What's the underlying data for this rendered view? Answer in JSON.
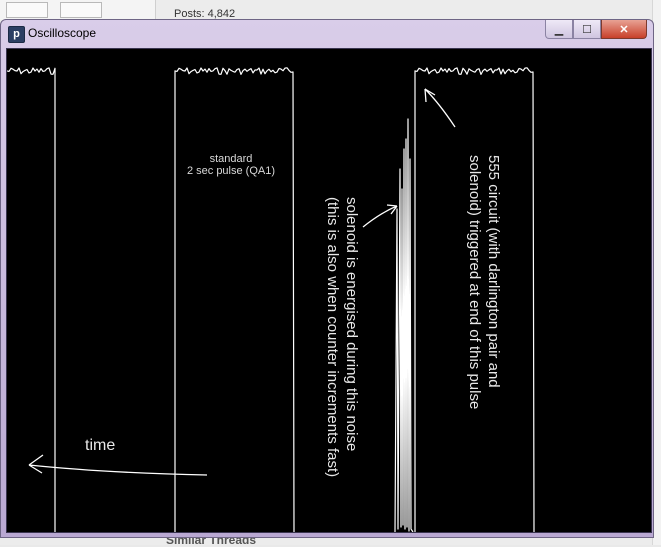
{
  "background": {
    "posts_text": "Posts: 4,842",
    "similar_threads": "Similar Threads"
  },
  "window": {
    "title": "Oscilloscope",
    "app_icon_glyph": "p",
    "controls": {
      "minimize": "▁",
      "maximize": "☐",
      "close": "✕"
    }
  },
  "scope": {
    "standard_line1": "standard",
    "standard_line2": "2 sec pulse (QA1)",
    "circuit_line1": "555 circuit (with darlington pair and",
    "circuit_line2": "solenoid) triggered at end of this pulse",
    "solenoid_line1": "solenoid is energised during this noise",
    "solenoid_line2": "(this is also when counter increments fast)",
    "time_label": "time",
    "trace_color": "#ffffff"
  }
}
